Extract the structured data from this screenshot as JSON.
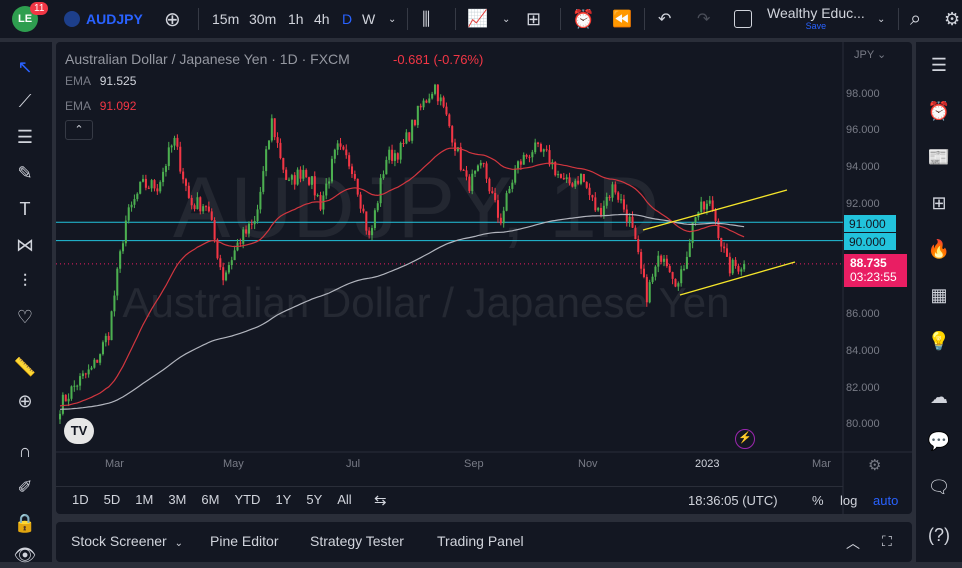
{
  "topbar": {
    "notifications": "11",
    "symbol": "AUDJPY",
    "intervals": [
      "15m",
      "30m",
      "1h",
      "4h",
      "D",
      "W"
    ],
    "active_interval": "D",
    "layout_name": "Wealthy Educ...",
    "save_label": "Save"
  },
  "legend": {
    "title": "Australian Dollar / Japanese Yen · 1D · FXCM",
    "change": "-0.681 (-0.76%)",
    "ema1_label": "EMA",
    "ema1_value": "91.525",
    "ema2_label": "EMA",
    "ema2_value": "91.092"
  },
  "watermark": {
    "symbol": "AUDJPY, 1D",
    "name": "Australian Dollar / Japanese Yen"
  },
  "price_axis": {
    "currency": "JPY",
    "ticks": [
      "98.000",
      "96.000",
      "94.000",
      "92.000",
      "86.000",
      "84.000",
      "82.000",
      "80.000"
    ],
    "levels": [
      "91.000",
      "90.000"
    ],
    "last_price": "88.735",
    "countdown": "03:23:55"
  },
  "time_axis": {
    "ticks": [
      "Mar",
      "May",
      "Jul",
      "Sep",
      "Nov",
      "2023",
      "Mar"
    ]
  },
  "range_bar": {
    "ranges": [
      "1D",
      "5D",
      "1M",
      "3M",
      "6M",
      "YTD",
      "1Y",
      "5Y",
      "All"
    ],
    "clock": "18:36:05 (UTC)",
    "percent": "%",
    "log": "log",
    "auto": "auto"
  },
  "panel_tabs": [
    "Stock Screener",
    "Pine Editor",
    "Strategy Tester",
    "Trading Panel"
  ],
  "colors": {
    "up": "#26a69a",
    "upbright": "#4caf50",
    "down": "#f23645",
    "level": "#22c3dc",
    "trend": "#f5e52a",
    "ema_fast": "#d2363f",
    "ema_slow": "#b2b5be",
    "last": "#e91e63"
  },
  "chart_data": {
    "type": "candlestick",
    "symbol": "AUDJPY",
    "approx_closes": [
      81,
      82.2,
      83,
      85,
      91,
      93,
      93,
      95.5,
      92,
      92,
      88,
      90,
      91,
      96.5,
      93,
      94,
      92,
      95,
      94,
      90,
      94.5,
      95,
      97,
      98.5,
      96,
      93,
      94,
      91,
      94,
      95,
      94.5,
      93,
      93.5,
      91.5,
      93,
      91,
      87,
      89.5,
      87.5,
      91.5,
      92,
      88.5,
      88.735
    ],
    "levels": [
      91,
      90
    ],
    "ylim": [
      79,
      99.5
    ]
  }
}
